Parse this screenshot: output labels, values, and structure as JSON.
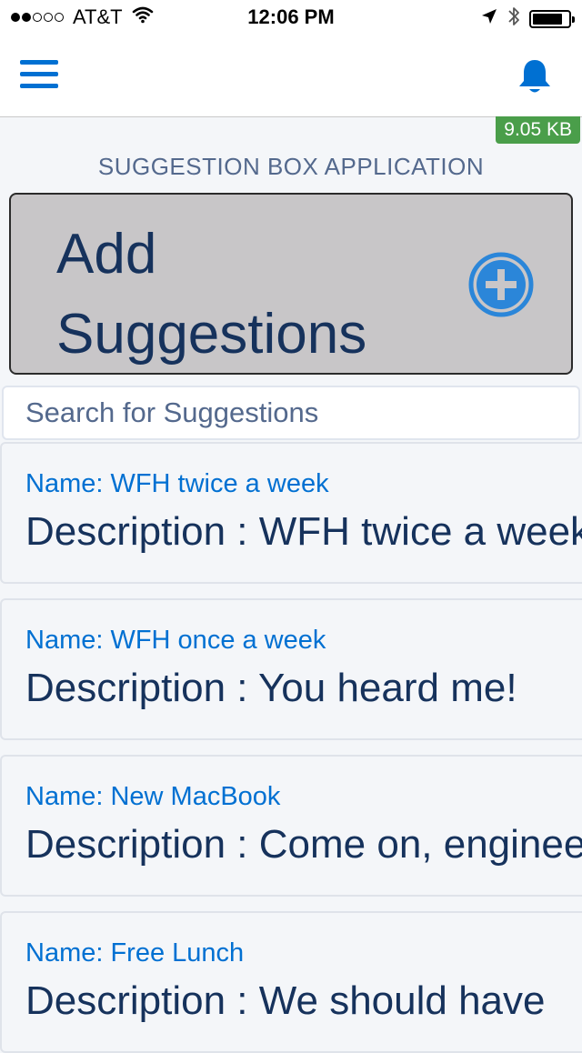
{
  "status_bar": {
    "signal_full": 2,
    "signal_empty": 3,
    "carrier": "AT&T",
    "time": "12:06 PM",
    "battery_level": 0.85
  },
  "nav": {
    "menu_icon": "hamburger-icon",
    "notification_icon": "bell-icon",
    "accent_color": "#0070d2"
  },
  "badge": {
    "size": "9.05 KB",
    "color": "#4a9e4a"
  },
  "app": {
    "title": "SUGGESTION BOX APPLICATION",
    "add_label": "Add Suggestions",
    "add_icon": "plus-circle-icon"
  },
  "search": {
    "placeholder": "Search for Suggestions",
    "value": ""
  },
  "suggestions": [
    {
      "name": "Name: WFH twice a week",
      "description": "Description : WFH twice a week"
    },
    {
      "name": "Name: WFH once a week",
      "description": "Description : You heard me!"
    },
    {
      "name": "Name: New MacBook",
      "description": "Description : Come on, engineers"
    },
    {
      "name": "Name: Free Lunch",
      "description": "Description : We should have"
    }
  ]
}
